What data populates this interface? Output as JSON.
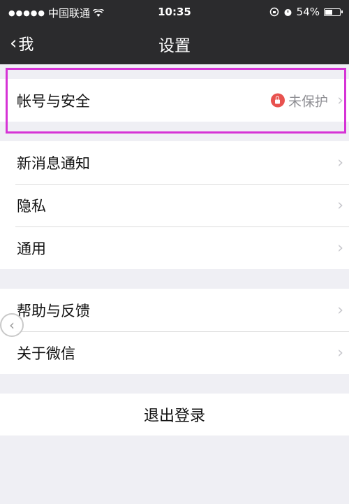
{
  "status_bar": {
    "signal": "●●●●●",
    "carrier": "中国联通",
    "wifi_icon": "wifi-icon",
    "time": "10:35",
    "battery": "54%",
    "battery_level": 0.54
  },
  "nav": {
    "back_label": "我",
    "title": "设置"
  },
  "group1": [
    {
      "label": "帐号与安全",
      "status": "未保护"
    }
  ],
  "group2": [
    {
      "label": "新消息通知"
    },
    {
      "label": "隐私"
    },
    {
      "label": "通用"
    }
  ],
  "group3": [
    {
      "label": "帮助与反馈"
    },
    {
      "label": "关于微信"
    }
  ],
  "logout": "退出登录",
  "colors": {
    "nav_bg": "#2b2b2d",
    "highlight": "#d633d6",
    "warning": "#e8524f"
  }
}
